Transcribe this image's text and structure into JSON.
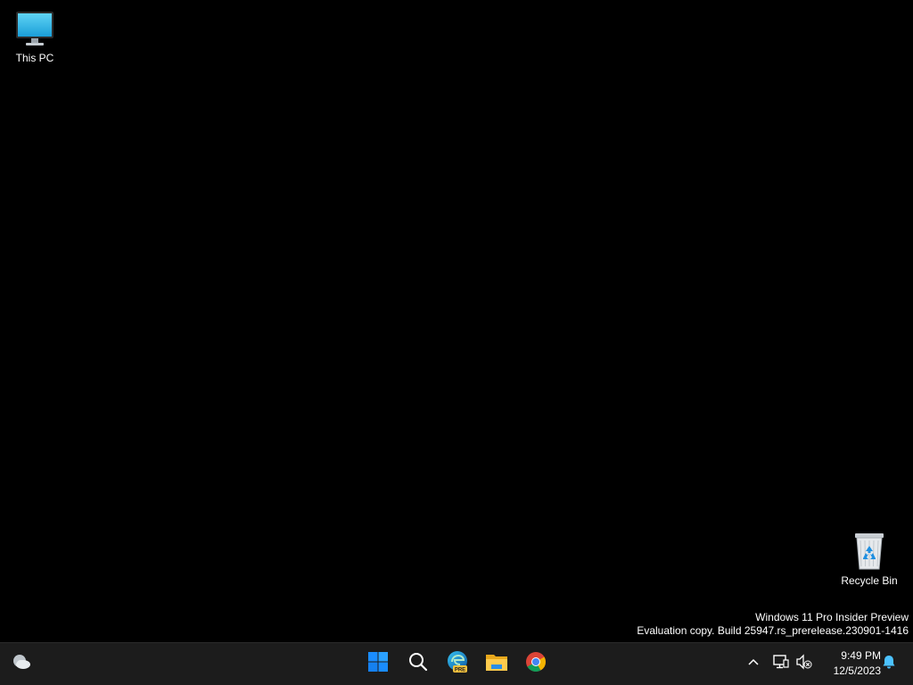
{
  "desktop": {
    "icons": [
      {
        "label": "This PC",
        "icon": "monitor-icon"
      },
      {
        "label": "Recycle Bin",
        "icon": "recycle-bin-icon"
      }
    ],
    "watermark": {
      "line1": "Windows 11 Pro Insider Preview",
      "line2": "Evaluation copy. Build 25947.rs_prerelease.230901-1416"
    }
  },
  "taskbar": {
    "pinned": [
      {
        "name": "Widgets",
        "icon": "weather-icon"
      },
      {
        "name": "Start",
        "icon": "windows-start-icon"
      },
      {
        "name": "Search",
        "icon": "search-icon"
      },
      {
        "name": "Microsoft Edge Preview",
        "icon": "edge-preview-icon",
        "badge": "PRE"
      },
      {
        "name": "File Explorer",
        "icon": "folder-icon"
      },
      {
        "name": "Google Chrome",
        "icon": "chrome-icon"
      }
    ],
    "tray": {
      "chevron_icon": "chevron-up-icon",
      "network_icon": "network-icon",
      "volume_icon": "volume-muted-icon",
      "time": "9:49 PM",
      "date": "12/5/2023",
      "notification_icon": "bell-icon"
    }
  },
  "colors": {
    "desktop_background": "#000000",
    "taskbar_background": "#1c1c1c",
    "start_blue": "#0a84ff",
    "bell_blue": "#4cc2ff"
  }
}
